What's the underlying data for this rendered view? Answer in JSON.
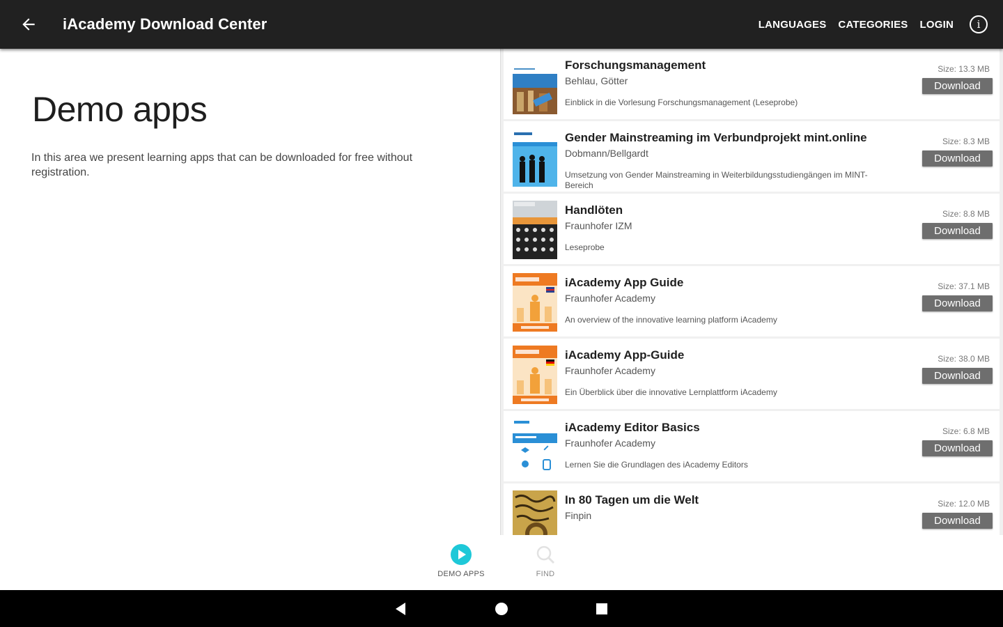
{
  "appbar": {
    "title": "iAcademy Download Center",
    "actions": [
      "LANGUAGES",
      "CATEGORIES",
      "LOGIN"
    ],
    "info_icon": "info-icon",
    "back_icon": "arrow-back-icon"
  },
  "main": {
    "title": "Demo apps",
    "description": "In this area we present learning apps that can be downloaded for free without registration."
  },
  "apps": [
    {
      "name": "Forschungsmanagement",
      "author": "Behlau, Götter",
      "description": "Einblick in die Vorlesung Forschungsmanagement (Leseprobe)",
      "size": "Size: 13.3 MB",
      "button": "Download"
    },
    {
      "name": "Gender Mainstreaming im Verbundprojekt mint.online",
      "author": "Dobmann/Bellgardt",
      "description": "Umsetzung von Gender Mainstreaming in Weiterbildungsstudiengängen im MINT-Bereich",
      "size": "Size: 8.3 MB",
      "button": "Download"
    },
    {
      "name": "Handlöten",
      "author": "Fraunhofer IZM",
      "description": "Leseprobe",
      "size": "Size: 8.8 MB",
      "button": "Download"
    },
    {
      "name": "iAcademy App Guide",
      "author": "Fraunhofer Academy",
      "description": "An overview of the innovative learning platform iAcademy",
      "size": "Size: 37.1 MB",
      "button": "Download"
    },
    {
      "name": "iAcademy App-Guide",
      "author": "Fraunhofer Academy",
      "description": "Ein Überblick über die innovative Lernplattform iAcademy",
      "size": "Size: 38.0 MB",
      "button": "Download"
    },
    {
      "name": "iAcademy Editor Basics",
      "author": "Fraunhofer Academy",
      "description": "Lernen Sie die Grundlagen des iAcademy Editors",
      "size": "Size: 6.8 MB",
      "button": "Download"
    },
    {
      "name": "In 80 Tagen um die Welt",
      "author": "Finpin",
      "description": "",
      "size": "Size: 12.0 MB",
      "button": "Download"
    }
  ],
  "bottom_nav": [
    {
      "label": "DEMO APPS",
      "icon": "play-circle-icon",
      "active": true
    },
    {
      "label": "FIND",
      "icon": "search-icon",
      "active": false
    }
  ],
  "system_nav": {
    "back": "triangle-back-icon",
    "home": "circle-home-icon",
    "recents": "square-recents-icon"
  },
  "colors": {
    "appbar": "#212121",
    "accent": "#1ec8d8",
    "button": "#6e6e6e",
    "list_bg": "#f0f0f0"
  }
}
